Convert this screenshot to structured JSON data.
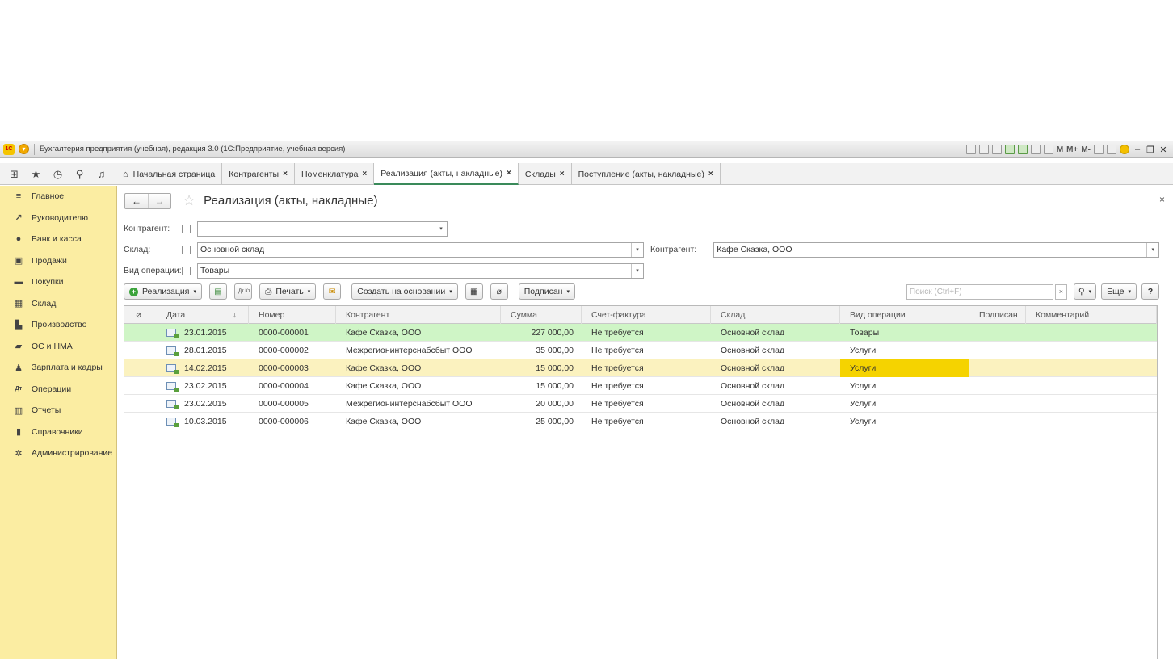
{
  "titlebar": {
    "logo": "1С",
    "title": "Бухгалтерия предприятия (учебная), редакция 3.0  (1С:Предприятие, учебная версия)",
    "tools_text": [
      "M",
      "M+",
      "M-"
    ]
  },
  "nav_icons": [
    "apps-grid-icon",
    "star-icon",
    "history-icon",
    "search-icon",
    "bell-icon"
  ],
  "tabs": [
    {
      "label": "Начальная страница",
      "closable": false,
      "active": false
    },
    {
      "label": "Контрагенты",
      "closable": true,
      "active": false
    },
    {
      "label": "Номенклатура",
      "closable": true,
      "active": false
    },
    {
      "label": "Реализация (акты, накладные)",
      "closable": true,
      "active": true
    },
    {
      "label": "Склады",
      "closable": true,
      "active": false
    },
    {
      "label": "Поступление (акты, накладные)",
      "closable": true,
      "active": false
    }
  ],
  "sidebar": {
    "items": [
      {
        "label": "Главное",
        "icon": "menu-lines-icon"
      },
      {
        "label": "Руководителю",
        "icon": "trend-icon"
      },
      {
        "label": "Банк и касса",
        "icon": "coin-icon"
      },
      {
        "label": "Продажи",
        "icon": "bag-icon"
      },
      {
        "label": "Покупки",
        "icon": "cart-icon"
      },
      {
        "label": "Склад",
        "icon": "warehouse-icon"
      },
      {
        "label": "Производство",
        "icon": "factory-icon"
      },
      {
        "label": "ОС и НМА",
        "icon": "truck-icon"
      },
      {
        "label": "Зарплата и кадры",
        "icon": "person-icon"
      },
      {
        "label": "Операции",
        "icon": "dt-kt-icon"
      },
      {
        "label": "Отчеты",
        "icon": "bar-chart-icon"
      },
      {
        "label": "Справочники",
        "icon": "book-icon"
      },
      {
        "label": "Администрирование",
        "icon": "gear-icon"
      }
    ]
  },
  "form": {
    "title": "Реализация (акты, накладные)",
    "filters": {
      "kontragent1_label": "Контрагент:",
      "kontragent1_value": "",
      "sklad_label": "Склад:",
      "sklad_value": "Основной склад",
      "kontragent2_label": "Контрагент:",
      "kontragent2_value": "Кафе Сказка, ООО",
      "vid_label": "Вид операции:",
      "vid_value": "Товары"
    },
    "toolbar": {
      "realizaciya": "Реализация",
      "print": "Печать",
      "create_based": "Создать на основании",
      "signed": "Подписан",
      "search_placeholder": "Поиск (Ctrl+F)",
      "more": "Еще",
      "help": "?",
      "dtkt": "Дт Кт"
    }
  },
  "table": {
    "columns": [
      "Дата",
      "Номер",
      "Контрагент",
      "Сумма",
      "Счет-фактура",
      "Склад",
      "Вид операции",
      "Подписан",
      "Комментарий"
    ],
    "rows": [
      {
        "date": "23.01.2015",
        "number": "0000-000001",
        "kontragent": "Кафе Сказка, ООО",
        "sum": "227 000,00",
        "sf": "Не требуется",
        "sklad": "Основной склад",
        "vid": "Товары",
        "podpisan": "",
        "comment": "",
        "state": "green"
      },
      {
        "date": "28.01.2015",
        "number": "0000-000002",
        "kontragent": "Межрегионинтерснабсбыт ООО",
        "sum": "35 000,00",
        "sf": "Не требуется",
        "sklad": "Основной склад",
        "vid": "Услуги",
        "podpisan": "",
        "comment": "",
        "state": ""
      },
      {
        "date": "14.02.2015",
        "number": "0000-000003",
        "kontragent": "Кафе Сказка, ООО",
        "sum": "15 000,00",
        "sf": "Не требуется",
        "sklad": "Основной склад",
        "vid": "Услуги",
        "podpisan": "",
        "comment": "",
        "state": "yellow"
      },
      {
        "date": "23.02.2015",
        "number": "0000-000004",
        "kontragent": "Кафе Сказка, ООО",
        "sum": "15 000,00",
        "sf": "Не требуется",
        "sklad": "Основной склад",
        "vid": "Услуги",
        "podpisan": "",
        "comment": "",
        "state": ""
      },
      {
        "date": "23.02.2015",
        "number": "0000-000005",
        "kontragent": "Межрегионинтерснабсбыт ООО",
        "sum": "20 000,00",
        "sf": "Не требуется",
        "sklad": "Основной склад",
        "vid": "Услуги",
        "podpisan": "",
        "comment": "",
        "state": ""
      },
      {
        "date": "10.03.2015",
        "number": "0000-000006",
        "kontragent": "Кафе Сказка, ООО",
        "sum": "25 000,00",
        "sf": "Не требуется",
        "sklad": "Основной склад",
        "vid": "Услуги",
        "podpisan": "",
        "comment": "",
        "state": ""
      }
    ]
  }
}
